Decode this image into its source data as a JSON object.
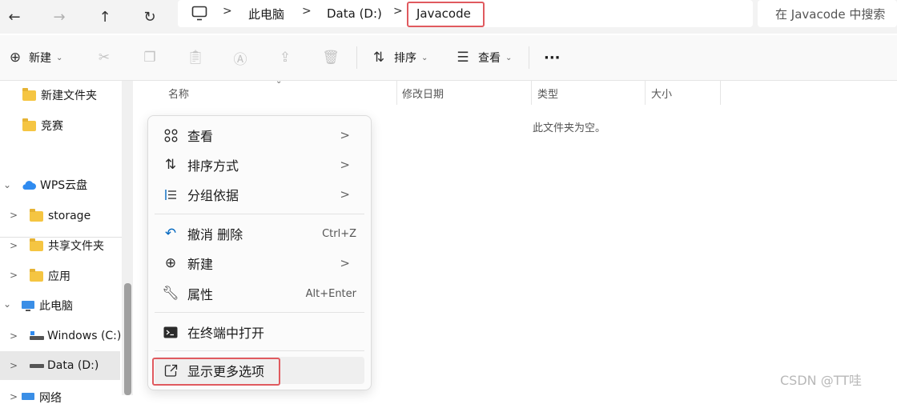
{
  "address": {
    "crumbs": [
      "此电脑",
      "Data (D:)",
      "Javacode"
    ],
    "search_placeholder": "在 Javacode 中搜索"
  },
  "toolbar": {
    "new_label": "新建",
    "sort_label": "排序",
    "view_label": "查看",
    "more_label": "···"
  },
  "sidebar": {
    "items": [
      {
        "label": "新建文件夹"
      },
      {
        "label": "竞赛"
      },
      {
        "label": "WPS云盘"
      },
      {
        "label": "storage"
      },
      {
        "label": "共享文件夹"
      },
      {
        "label": "应用"
      },
      {
        "label": "此电脑"
      },
      {
        "label": "Windows (C:)"
      },
      {
        "label": "Data (D:)"
      },
      {
        "label": "网络"
      }
    ]
  },
  "columns": {
    "name": "名称",
    "date": "修改日期",
    "type": "类型",
    "size": "大小"
  },
  "empty_message": "此文件夹为空。",
  "context_menu": {
    "items": [
      {
        "label": "查看"
      },
      {
        "label": "排序方式"
      },
      {
        "label": "分组依据"
      },
      {
        "label": "撤消 删除",
        "shortcut": "Ctrl+Z"
      },
      {
        "label": "新建"
      },
      {
        "label": "属性",
        "shortcut": "Alt+Enter"
      },
      {
        "label": "在终端中打开"
      },
      {
        "label": "显示更多选项"
      }
    ]
  },
  "watermark": "CSDN @TT哇",
  "colors": {
    "highlight": "#e05a5f",
    "folder": "#f5c542",
    "accent": "#0067c0"
  }
}
